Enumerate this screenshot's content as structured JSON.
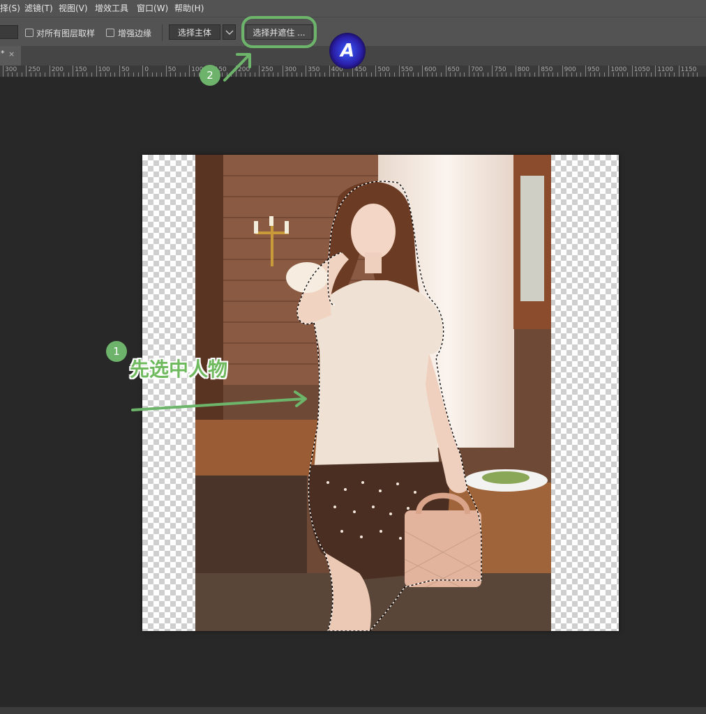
{
  "menubar": {
    "items": [
      {
        "label": "择(S)"
      },
      {
        "label": "滤镜(T)"
      },
      {
        "label": "视图(V)"
      },
      {
        "label": "增效工具"
      },
      {
        "label": "窗口(W)"
      },
      {
        "label": "帮助(H)"
      }
    ]
  },
  "options": {
    "sample_all_layers": {
      "label": "对所有图层取样",
      "checked": false
    },
    "enhance_edge": {
      "label": "增强边缘",
      "checked": false
    },
    "select_subject": "选择主体",
    "select_and_mask": "选择并遮住 ..."
  },
  "tab": {
    "title": "*",
    "close": "×"
  },
  "ruler": {
    "labels": [
      "300",
      "250",
      "200",
      "150",
      "100",
      "50",
      "0",
      "50",
      "100",
      "150",
      "200",
      "250",
      "300",
      "350",
      "400",
      "450",
      "500",
      "550",
      "600",
      "650",
      "700",
      "750",
      "800",
      "850",
      "900",
      "950",
      "1000",
      "1050",
      "1100",
      "1150"
    ]
  },
  "annotations": {
    "step1": {
      "number": "1",
      "text": "先选中人物"
    },
    "step2": {
      "number": "2"
    }
  },
  "colors": {
    "annotation_green": "#6cb56a",
    "panel": "#535353",
    "workspace": "#282828"
  },
  "icons": {
    "logo": "A"
  }
}
